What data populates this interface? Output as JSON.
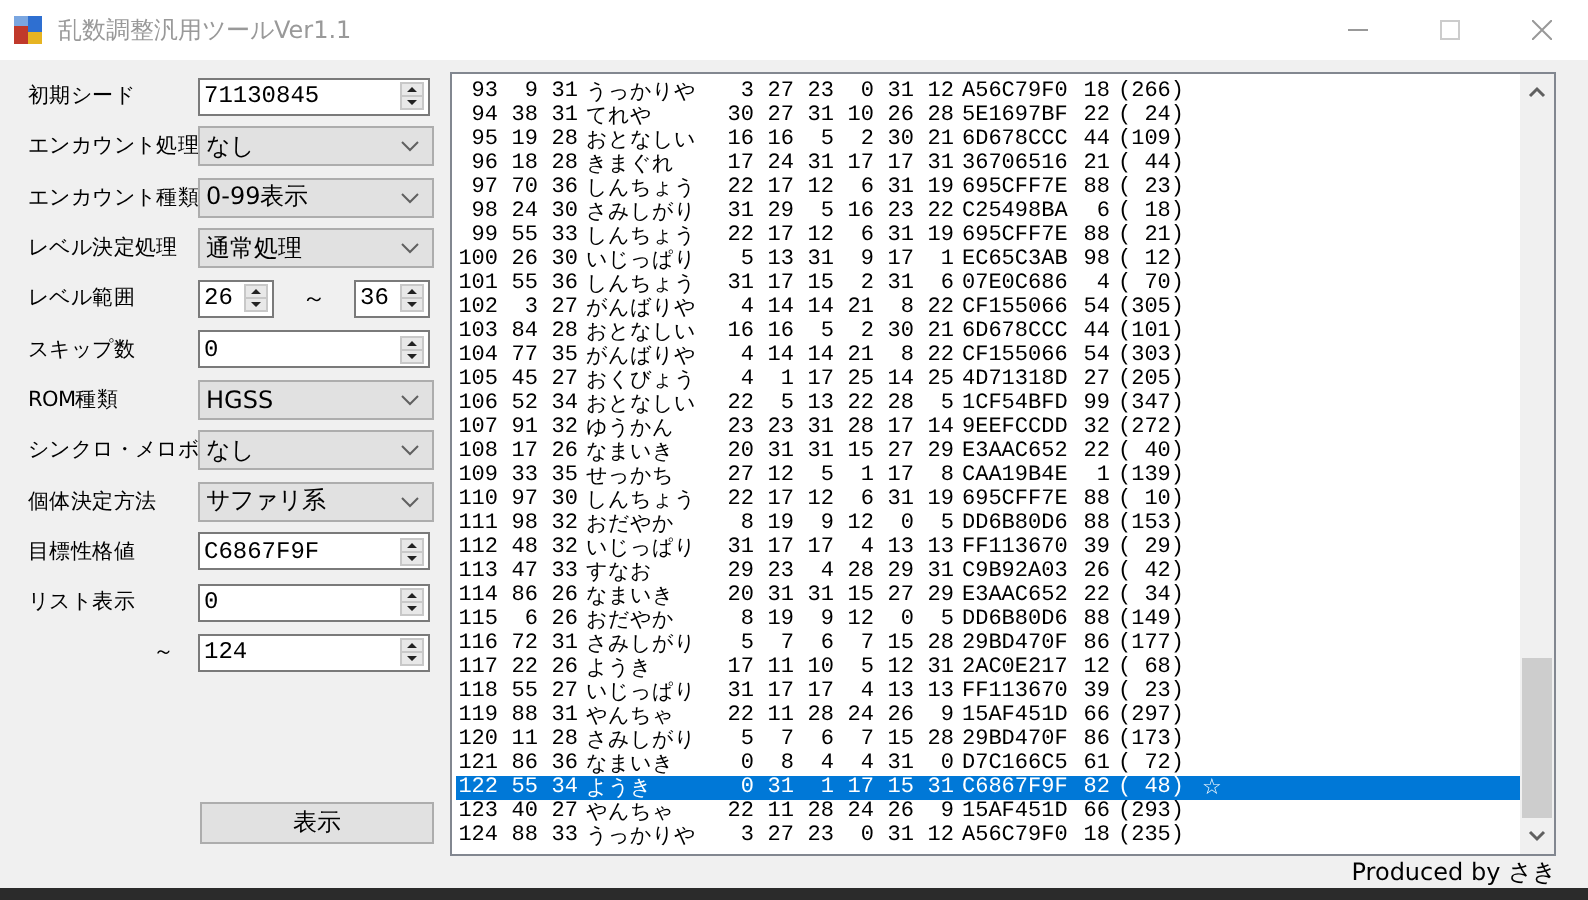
{
  "window": {
    "title": "乱数調整汎用ツールVer1.1"
  },
  "form": {
    "fields": [
      {
        "label": "初期シード",
        "kind": "spin",
        "value": "71130845"
      },
      {
        "label": "エンカウント処理",
        "kind": "combo",
        "value": "なし"
      },
      {
        "label": "エンカウント種類",
        "kind": "combo",
        "value": "0-99表示"
      },
      {
        "label": "レベル決定処理",
        "kind": "combo",
        "value": "通常処理"
      },
      {
        "label": "レベル範囲",
        "kind": "range",
        "value": "26",
        "separator": "～",
        "value_to": "36"
      },
      {
        "label": "スキップ数",
        "kind": "spin",
        "value": "0"
      },
      {
        "label": "ROM種類",
        "kind": "combo",
        "value": "HGSS"
      },
      {
        "label": "シンクロ・メロボ",
        "kind": "combo",
        "value": "なし"
      },
      {
        "label": "個体決定方法",
        "kind": "combo",
        "value": "サファリ系"
      },
      {
        "label": "目標性格値",
        "kind": "spin",
        "value": "C6867F9F"
      },
      {
        "label": "リスト表示",
        "kind": "spin",
        "value": "0"
      },
      {
        "label": "～",
        "kind": "range-end",
        "value": "124"
      }
    ],
    "button": "表示"
  },
  "list": {
    "rows": [
      {
        "cells": [
          "93",
          "9",
          "31",
          "うっかりや",
          "3",
          "27",
          "23",
          "0",
          "31",
          "12",
          "A56C79F0",
          "18",
          "(266)"
        ],
        "selected": false
      },
      {
        "cells": [
          "94",
          "38",
          "31",
          "てれや",
          "30",
          "27",
          "31",
          "10",
          "26",
          "28",
          "5E1697BF",
          "22",
          "( 24)"
        ],
        "selected": false
      },
      {
        "cells": [
          "95",
          "19",
          "28",
          "おとなしい",
          "16",
          "16",
          "5",
          "2",
          "30",
          "21",
          "6D678CCC",
          "44",
          "(109)"
        ],
        "selected": false
      },
      {
        "cells": [
          "96",
          "18",
          "28",
          "きまぐれ",
          "17",
          "24",
          "31",
          "17",
          "17",
          "31",
          "36706516",
          "21",
          "( 44)"
        ],
        "selected": false
      },
      {
        "cells": [
          "97",
          "70",
          "36",
          "しんちょう",
          "22",
          "17",
          "12",
          "6",
          "31",
          "19",
          "695CFF7E",
          "88",
          "( 23)"
        ],
        "selected": false
      },
      {
        "cells": [
          "98",
          "24",
          "30",
          "さみしがり",
          "31",
          "29",
          "5",
          "16",
          "23",
          "22",
          "C25498BA",
          "6",
          "( 18)"
        ],
        "selected": false
      },
      {
        "cells": [
          "99",
          "55",
          "33",
          "しんちょう",
          "22",
          "17",
          "12",
          "6",
          "31",
          "19",
          "695CFF7E",
          "88",
          "( 21)"
        ],
        "selected": false
      },
      {
        "cells": [
          "100",
          "26",
          "30",
          "いじっぱり",
          "5",
          "13",
          "31",
          "9",
          "17",
          "1",
          "EC65C3AB",
          "98",
          "( 12)"
        ],
        "selected": false
      },
      {
        "cells": [
          "101",
          "55",
          "36",
          "しんちょう",
          "31",
          "17",
          "15",
          "2",
          "31",
          "6",
          "07E0C686",
          "4",
          "( 70)"
        ],
        "selected": false
      },
      {
        "cells": [
          "102",
          "3",
          "27",
          "がんばりや",
          "4",
          "14",
          "14",
          "21",
          "8",
          "22",
          "CF155066",
          "54",
          "(305)"
        ],
        "selected": false
      },
      {
        "cells": [
          "103",
          "84",
          "28",
          "おとなしい",
          "16",
          "16",
          "5",
          "2",
          "30",
          "21",
          "6D678CCC",
          "44",
          "(101)"
        ],
        "selected": false
      },
      {
        "cells": [
          "104",
          "77",
          "35",
          "がんばりや",
          "4",
          "14",
          "14",
          "21",
          "8",
          "22",
          "CF155066",
          "54",
          "(303)"
        ],
        "selected": false
      },
      {
        "cells": [
          "105",
          "45",
          "27",
          "おくびょう",
          "4",
          "1",
          "17",
          "25",
          "14",
          "25",
          "4D71318D",
          "27",
          "(205)"
        ],
        "selected": false
      },
      {
        "cells": [
          "106",
          "52",
          "34",
          "おとなしい",
          "22",
          "5",
          "13",
          "22",
          "28",
          "5",
          "1CF54BFD",
          "99",
          "(347)"
        ],
        "selected": false
      },
      {
        "cells": [
          "107",
          "91",
          "32",
          "ゆうかん",
          "23",
          "23",
          "31",
          "28",
          "17",
          "14",
          "9EEFCCDD",
          "32",
          "(272)"
        ],
        "selected": false
      },
      {
        "cells": [
          "108",
          "17",
          "26",
          "なまいき",
          "20",
          "31",
          "31",
          "15",
          "27",
          "29",
          "E3AAC652",
          "22",
          "( 40)"
        ],
        "selected": false
      },
      {
        "cells": [
          "109",
          "33",
          "35",
          "せっかち",
          "27",
          "12",
          "5",
          "1",
          "17",
          "8",
          "CAA19B4E",
          "1",
          "(139)"
        ],
        "selected": false
      },
      {
        "cells": [
          "110",
          "97",
          "30",
          "しんちょう",
          "22",
          "17",
          "12",
          "6",
          "31",
          "19",
          "695CFF7E",
          "88",
          "( 10)"
        ],
        "selected": false
      },
      {
        "cells": [
          "111",
          "98",
          "32",
          "おだやか",
          "8",
          "19",
          "9",
          "12",
          "0",
          "5",
          "DD6B80D6",
          "88",
          "(153)"
        ],
        "selected": false
      },
      {
        "cells": [
          "112",
          "48",
          "32",
          "いじっぱり",
          "31",
          "17",
          "17",
          "4",
          "13",
          "13",
          "FF113670",
          "39",
          "( 29)"
        ],
        "selected": false
      },
      {
        "cells": [
          "113",
          "47",
          "33",
          "すなお",
          "29",
          "23",
          "4",
          "28",
          "29",
          "31",
          "C9B92A03",
          "26",
          "( 42)"
        ],
        "selected": false
      },
      {
        "cells": [
          "114",
          "86",
          "26",
          "なまいき",
          "20",
          "31",
          "31",
          "15",
          "27",
          "29",
          "E3AAC652",
          "22",
          "( 34)"
        ],
        "selected": false
      },
      {
        "cells": [
          "115",
          "6",
          "26",
          "おだやか",
          "8",
          "19",
          "9",
          "12",
          "0",
          "5",
          "DD6B80D6",
          "88",
          "(149)"
        ],
        "selected": false
      },
      {
        "cells": [
          "116",
          "72",
          "31",
          "さみしがり",
          "5",
          "7",
          "6",
          "7",
          "15",
          "28",
          "29BD470F",
          "86",
          "(177)"
        ],
        "selected": false
      },
      {
        "cells": [
          "117",
          "22",
          "26",
          "ようき",
          "17",
          "11",
          "10",
          "5",
          "12",
          "31",
          "2AC0E217",
          "12",
          "( 68)"
        ],
        "selected": false
      },
      {
        "cells": [
          "118",
          "55",
          "27",
          "いじっぱり",
          "31",
          "17",
          "17",
          "4",
          "13",
          "13",
          "FF113670",
          "39",
          "( 23)"
        ],
        "selected": false
      },
      {
        "cells": [
          "119",
          "88",
          "31",
          "やんちゃ",
          "22",
          "11",
          "28",
          "24",
          "26",
          "9",
          "15AF451D",
          "66",
          "(297)"
        ],
        "selected": false
      },
      {
        "cells": [
          "120",
          "11",
          "28",
          "さみしがり",
          "5",
          "7",
          "6",
          "7",
          "15",
          "28",
          "29BD470F",
          "86",
          "(173)"
        ],
        "selected": false
      },
      {
        "cells": [
          "121",
          "86",
          "36",
          "なまいき",
          "0",
          "8",
          "4",
          "4",
          "31",
          "0",
          "D7C166C5",
          "61",
          "( 72)"
        ],
        "selected": false
      },
      {
        "cells": [
          "122",
          "55",
          "34",
          "ようき",
          "0",
          "31",
          "1",
          "17",
          "15",
          "31",
          "C6867F9F",
          "82",
          "( 48)"
        ],
        "selected": true,
        "mark": "☆"
      },
      {
        "cells": [
          "123",
          "40",
          "27",
          "やんちゃ",
          "22",
          "11",
          "28",
          "24",
          "26",
          "9",
          "15AF451D",
          "66",
          "(293)"
        ],
        "selected": false
      },
      {
        "cells": [
          "124",
          "88",
          "33",
          "うっかりや",
          "3",
          "27",
          "23",
          "0",
          "31",
          "12",
          "A56C79F0",
          "18",
          "(235)"
        ],
        "selected": false
      }
    ]
  },
  "status_bar": {
    "text": "Produced by さき"
  }
}
